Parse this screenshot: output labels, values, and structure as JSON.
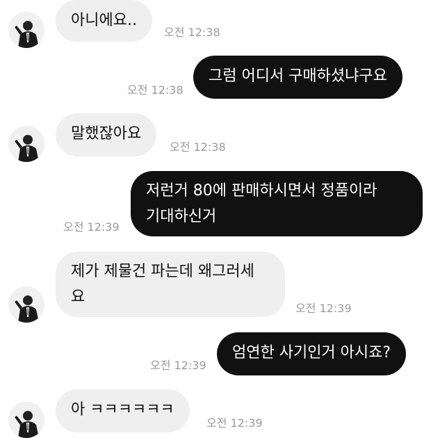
{
  "colors": {
    "incoming_bubble": "#efefef",
    "outgoing_bubble": "#111111",
    "timestamp": "#9a9a9a"
  },
  "avatar_icon": "profile-photo",
  "messages": [
    {
      "direction": "in",
      "text": "아니에요..",
      "time": "오전 12:38"
    },
    {
      "direction": "out",
      "text": "그럼 어디서 구매하셨냐구요",
      "time": "오전 12:38"
    },
    {
      "direction": "in",
      "text": "말했잖아요",
      "time": "오전 12:38"
    },
    {
      "direction": "out",
      "line1": "저런거 80에 판매하시면서 정품이라",
      "line2": "기대하신거",
      "time": "오전 12:39"
    },
    {
      "direction": "in",
      "line1": "제가 제물건 파는데 왜그러세",
      "line2": "요",
      "time": "오전 12:39"
    },
    {
      "direction": "out",
      "text": "엄연한 사기인거 아시죠?",
      "time": "오전 12:39"
    },
    {
      "direction": "in",
      "text": "아 ㅋㅋㅋㅋㅋㅋ",
      "time": "오전 12:39"
    }
  ]
}
